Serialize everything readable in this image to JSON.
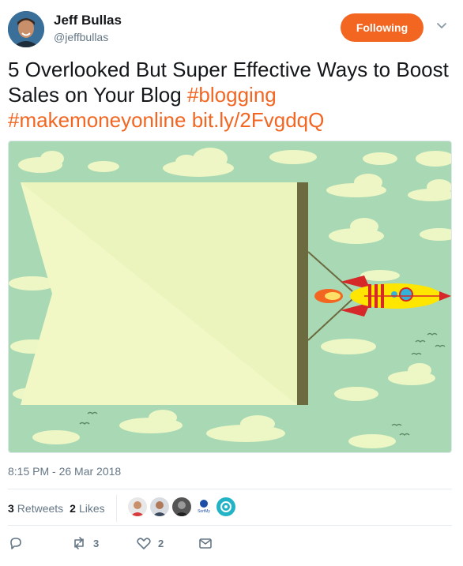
{
  "user": {
    "name": "Jeff Bullas",
    "handle": "@jeffbullas",
    "follow_label": "Following"
  },
  "tweet": {
    "text_plain": "5 Overlooked But Super Effective Ways to Boost Sales on Your Blog ",
    "hashtag1": "#blogging",
    "hashtag2": "#makemoneyonline",
    "link": "bit.ly/2FvgdqQ",
    "timestamp": "8:15 PM - 26 Mar 2018"
  },
  "stats": {
    "retweets_count": "3",
    "retweets_label": "Retweets",
    "likes_count": "2",
    "likes_label": "Likes"
  },
  "likers": [
    {
      "name": "liker-avatar-1",
      "badge_text": ""
    },
    {
      "name": "liker-avatar-2",
      "badge_text": ""
    },
    {
      "name": "liker-avatar-3",
      "badge_text": ""
    },
    {
      "name": "liker-avatar-4",
      "badge_text": "SortMy Social"
    },
    {
      "name": "liker-avatar-5",
      "badge_text": ""
    }
  ],
  "actions": {
    "reply_count": "",
    "retweet_count": "3",
    "like_count": "2"
  },
  "colors": {
    "accent": "#f26622",
    "sky": "#a8d8b4",
    "banner": "#f1f8c6",
    "pole": "#6b6b3f"
  }
}
